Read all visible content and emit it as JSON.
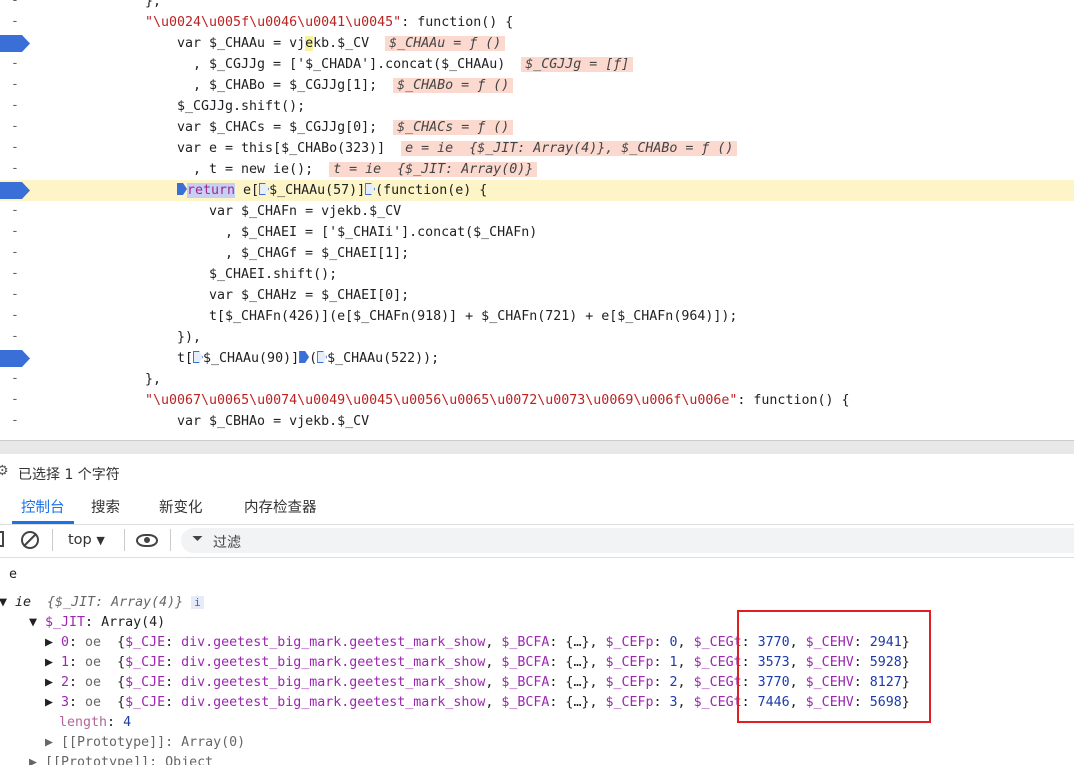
{
  "code": {
    "line0": "},",
    "line1_key": "\"\\u0024\\u005f\\u0046\\u0041\\u0045\"",
    "line1_rest": ": function() {",
    "line2_a": "var $_CHAAu = vj",
    "line2_b": "e",
    "line2_c": "kb.$_CV",
    "line2_ann": "$_CHAAu = ƒ ()",
    "line3_a": ", $_CGJJg = ['$_CHADA'].concat($_CHAAu)",
    "line3_ann": "$_CGJJg = [ƒ]",
    "line4_a": ", $_CHABo = $_CGJJg[1];",
    "line4_ann": "$_CHABo = ƒ ()",
    "line5": "$_CGJJg.shift();",
    "line6_a": "var $_CHACs = $_CGJJg[0];",
    "line6_ann": "$_CHACs = ƒ ()",
    "line7_a": "var e = this[$_CHABo(323)]",
    "line7_ann": "e = ie  {$_JIT: Array(4)}, $_CHABo = ƒ ()",
    "line8_a": ", t = new ie();",
    "line8_ann": "t = ie  {$_JIT: Array(0)}",
    "line9_return": "return",
    "line9_a": " e[",
    "line9_b": "$_CHAAu(57)]",
    "line9_c": "(function(e) {",
    "line10": "var $_CHAFn = vjekb.$_CV",
    "line11": ", $_CHAEI = ['$_CHAIi'].concat($_CHAFn)",
    "line12": ", $_CHAGf = $_CHAEI[1];",
    "line13": "$_CHAEI.shift();",
    "line14": "var $_CHAHz = $_CHAEI[0];",
    "line15": "t[$_CHAFn(426)](e[$_CHAFn(918)] + $_CHAFn(721) + e[$_CHAFn(964)]);",
    "line16": "}),",
    "line17_a": "t[",
    "line17_b": "$_CHAAu(90)]",
    "line17_c": "(",
    "line17_d": "$_CHAAu(522));",
    "line18": "},",
    "line19_key": "\"\\u0067\\u0065\\u0074\\u0049\\u0045\\u0056\\u0065\\u0072\\u0073\\u0069\\u006f\\u006e\"",
    "line19_rest": ": function() {",
    "line20": "var $_CBHAo = vjekb.$_CV"
  },
  "status": {
    "selected": "已选择 1 个字符"
  },
  "tabs": [
    {
      "label": "控制台"
    },
    {
      "label": "搜索"
    },
    {
      "label": "新变化"
    },
    {
      "label": "内存检查器"
    }
  ],
  "toolbar": {
    "context": "top",
    "filter_placeholder": "过滤"
  },
  "console": {
    "input": "e",
    "root_type": "ie",
    "root_preview": "{$_JIT: Array(4)}",
    "jit_key": "$_JIT",
    "jit_val": "Array(4)",
    "items": [
      {
        "index": "0",
        "type": "oe",
        "cje": "div.geetest_big_mark.geetest_mark_show",
        "fp": "0",
        "cegt": "3770",
        "cehv": "2941"
      },
      {
        "index": "1",
        "type": "oe",
        "cje": "div.geetest_big_mark.geetest_mark_show",
        "fp": "1",
        "cegt": "3573",
        "cehv": "5928"
      },
      {
        "index": "2",
        "type": "oe",
        "cje": "div.geetest_big_mark.geetest_mark_show",
        "fp": "2",
        "cegt": "3770",
        "cehv": "8127"
      },
      {
        "index": "3",
        "type": "oe",
        "cje": "div.geetest_big_mark.geetest_mark_show",
        "fp": "3",
        "cegt": "7446",
        "cehv": "5698"
      }
    ],
    "length_key": "length",
    "length_val": "4",
    "proto1": "[[Prototype]]: Array(0)",
    "proto2": "[[Prototype]]: Object"
  }
}
